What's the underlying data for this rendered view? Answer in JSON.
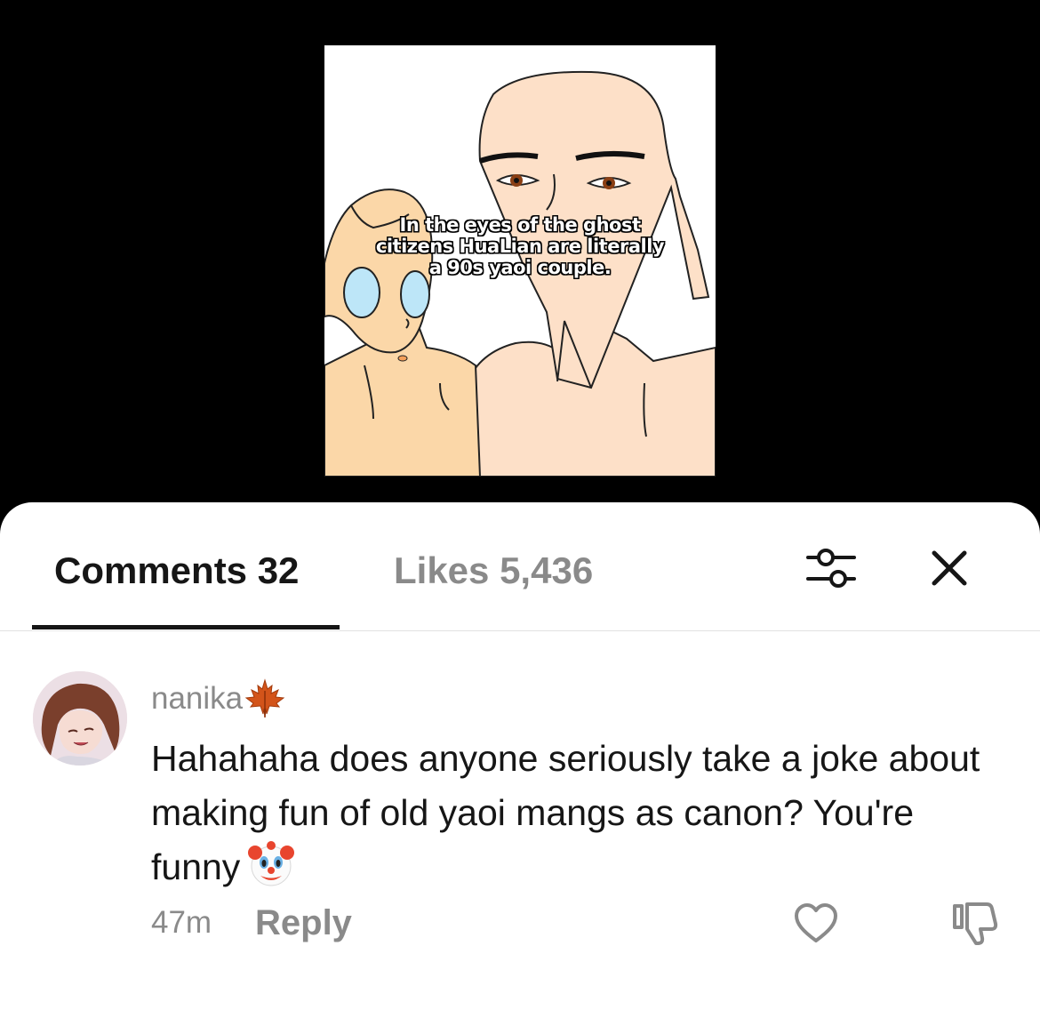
{
  "video": {
    "caption_lines": [
      "In the eyes of the ghost",
      "citizens HuaLian are literally",
      "a 90s yaoi couple."
    ]
  },
  "tabs": {
    "comments_label": "Comments 32",
    "likes_label": "Likes 5,436"
  },
  "comment": {
    "username": "nanika",
    "username_emoji": "maple-leaf-icon",
    "text": "Hahahaha does anyone seriously take a joke about making fun of old yaoi mangs as canon? You're funny",
    "text_emoji": "clown-face-icon",
    "time": "47m",
    "reply_label": "Reply"
  },
  "colors": {
    "primary_text": "#161616",
    "secondary_text": "#8a8a8a",
    "sheet_bg": "#ffffff",
    "video_bg": "#000000"
  }
}
